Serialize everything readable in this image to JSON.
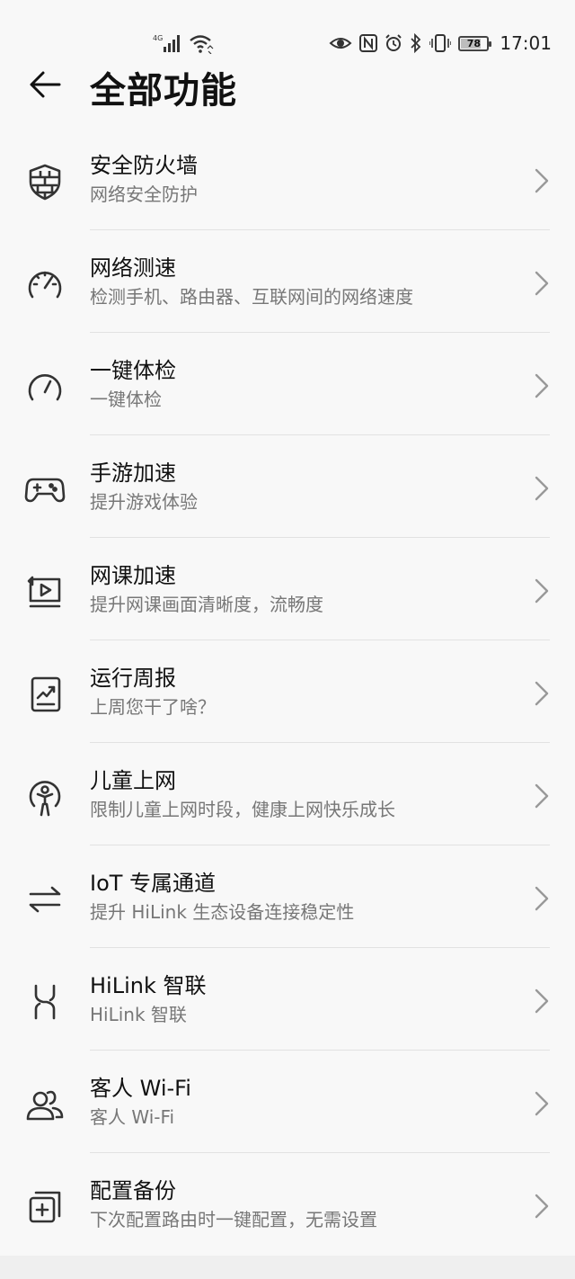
{
  "status_bar": {
    "network": "4G",
    "battery": "78",
    "battery_level": 0.78,
    "time": "17:01"
  },
  "header": {
    "back_icon": "arrow-left-icon",
    "title": "全部功能"
  },
  "items": [
    {
      "icon": "firewall-shield-icon",
      "title": "安全防火墙",
      "subtitle": "网络安全防护"
    },
    {
      "icon": "speedometer-icon",
      "title": "网络测速",
      "subtitle": "检测手机、路由器、互联网间的网络速度"
    },
    {
      "icon": "gauge-icon",
      "title": "一键体检",
      "subtitle": "一键体检"
    },
    {
      "icon": "gamepad-icon",
      "title": "手游加速",
      "subtitle": "提升游戏体验"
    },
    {
      "icon": "video-class-icon",
      "title": "网课加速",
      "subtitle": "提升网课画面清晰度，流畅度"
    },
    {
      "icon": "report-chart-icon",
      "title": "运行周报",
      "subtitle": "上周您干了啥？"
    },
    {
      "icon": "child-icon",
      "title": "儿童上网",
      "subtitle": "限制儿童上网时段，健康上网快乐成长"
    },
    {
      "icon": "swap-arrows-icon",
      "title": "IoT 专属通道",
      "subtitle": "提升 HiLink 生态设备连接稳定性"
    },
    {
      "icon": "hilink-icon",
      "title": "HiLink 智联",
      "subtitle": "HiLink 智联"
    },
    {
      "icon": "guest-users-icon",
      "title": "客人 Wi-Fi",
      "subtitle": "客人 Wi-Fi"
    },
    {
      "icon": "backup-config-icon",
      "title": "配置备份",
      "subtitle": "下次配置路由时一键配置，无需设置"
    }
  ]
}
